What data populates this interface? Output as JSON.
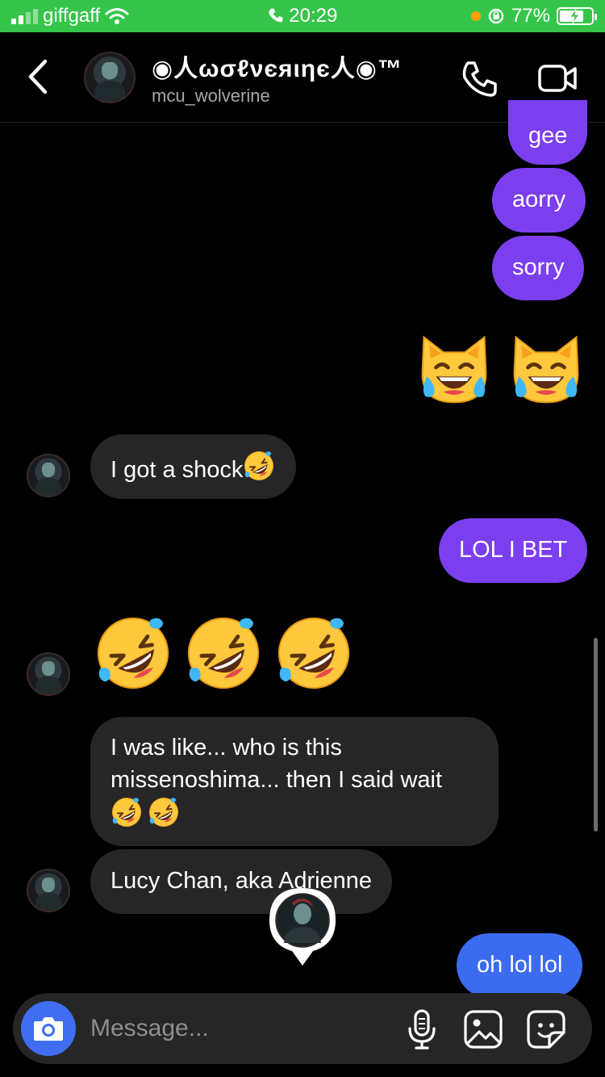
{
  "status_bar": {
    "carrier": "giffgaff",
    "time": "20:29",
    "battery": "77%",
    "battery_level": 0.77
  },
  "header": {
    "display_name": "◉人ωσℓνєяιηє人◉™",
    "username": "mcu_wolverine",
    "icons": [
      "back-chevron-icon",
      "phone-icon",
      "video-camera-icon"
    ]
  },
  "messages": [
    {
      "from": "me",
      "text": "gee"
    },
    {
      "from": "me",
      "text": "aorry"
    },
    {
      "from": "me",
      "text": "sorry"
    },
    {
      "from": "me",
      "emoji": [
        "cat-with-tears-of-joy",
        "cat-with-tears-of-joy"
      ]
    },
    {
      "from": "them",
      "text": "I got a shock",
      "trailing_emoji": [
        "rolling-on-floor-laughing"
      ]
    },
    {
      "from": "me",
      "text": "LOL I BET"
    },
    {
      "from": "them",
      "emoji": [
        "rolling-on-floor-laughing",
        "rolling-on-floor-laughing",
        "rolling-on-floor-laughing"
      ]
    },
    {
      "from": "them",
      "lines": [
        "I was like... who is this",
        "missenoshima... then I said wait"
      ],
      "trailing_emoji": [
        "rolling-on-floor-laughing",
        "rolling-on-floor-laughing"
      ]
    },
    {
      "from": "them",
      "text": "Lucy Chan, aka Adrienne"
    },
    {
      "from": "me",
      "text": "oh lol lol"
    }
  ],
  "composer": {
    "placeholder": "Message...",
    "icons": [
      "camera-icon",
      "microphone-icon",
      "gallery-icon",
      "sticker-icon"
    ]
  },
  "colors": {
    "status_bar": "#36c54a",
    "outgoing_bubble": "#7b3ff0",
    "outgoing_bubble_latest": "#3b6cf0",
    "incoming_bubble": "#262626",
    "camera_button": "#3f6ef2"
  }
}
